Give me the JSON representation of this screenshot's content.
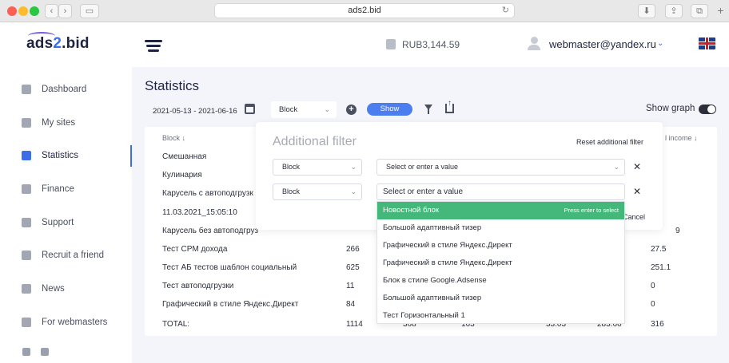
{
  "browser": {
    "url": "ads2.bid",
    "back_label": "‹",
    "forward_label": "›",
    "new_tab_label": "+"
  },
  "header": {
    "logo": {
      "prefix": "ads",
      "highlight": "2",
      "suffix": ".bid"
    },
    "balance": "RUB3,144.59",
    "user_email": "webmaster@yandex.ru",
    "language_flag": "uk-flag-icon"
  },
  "sidebar": {
    "items": [
      {
        "label": "Dashboard",
        "icon": "home-icon",
        "active": false
      },
      {
        "label": "My sites",
        "icon": "sites-icon",
        "active": false
      },
      {
        "label": "Statistics",
        "icon": "bar-chart-icon",
        "active": true
      },
      {
        "label": "Finance",
        "icon": "wallet-icon",
        "active": false
      },
      {
        "label": "Support",
        "icon": "chat-icon",
        "active": false
      },
      {
        "label": "Recruit a friend",
        "icon": "user-plus-icon",
        "active": false
      },
      {
        "label": "News",
        "icon": "news-icon",
        "active": false
      },
      {
        "label": "For webmasters",
        "icon": "info-icon",
        "active": false
      }
    ],
    "social": [
      "facebook-icon",
      "mail-icon"
    ]
  },
  "page": {
    "title": "Statistics",
    "date_range": "2021-05-13 - 2021-06-16",
    "block_select": "Block",
    "show_button": "Show",
    "show_graph_label": "Show graph",
    "show_graph_enabled": true
  },
  "table": {
    "headers": {
      "block": "Block ↓",
      "income": "l income ↓"
    },
    "rows": [
      {
        "block": "Смешанная",
        "c1": "",
        "c2": "",
        "c3": "",
        "c4": "",
        "c5": "",
        "c6": ""
      },
      {
        "block": "Кулинария",
        "c1": "",
        "c2": "",
        "c3": "",
        "c4": "",
        "c5": "",
        "c6": ""
      },
      {
        "block": "Карусель с автоподгрузк",
        "c1": "",
        "c2": "",
        "c3": "",
        "c4": "",
        "c5": "",
        "c6": ""
      },
      {
        "block": "11.03.2021_15:05:10",
        "c1": "",
        "c2": "",
        "c3": "",
        "c4": "",
        "c5": "",
        "c6": ""
      },
      {
        "block": "Карусель без автоподгруз",
        "c1": "",
        "c2": "",
        "c3": "",
        "c4": "",
        "c5": "",
        "c6": "9"
      },
      {
        "block": "Тест CPM дохода",
        "c1": "266",
        "c2": "",
        "c3": "",
        "c4": "",
        "c5": "",
        "c6": "27.5"
      },
      {
        "block": "Тест АБ тестов шаблон социальный",
        "c1": "625",
        "c2": "",
        "c3": "",
        "c4": "",
        "c5": "",
        "c6": "251.1"
      },
      {
        "block": "Тест автоподгрузки",
        "c1": "11",
        "c2": "",
        "c3": "",
        "c4": "",
        "c5": "",
        "c6": "0"
      },
      {
        "block": "Графический в стиле Яндекс.Директ",
        "c1": "84",
        "c2": "",
        "c3": "",
        "c4": "",
        "c5": "",
        "c6": "0"
      }
    ],
    "total": {
      "label": "TOTAL:",
      "c1": "1114",
      "c2": "368",
      "c3": "163",
      "c4": "33.03",
      "c5": "283.66",
      "c6": "316"
    }
  },
  "additional_filter": {
    "title": "Additional filter",
    "reset_label": "Reset additional filter",
    "cancel_label": "Cancel",
    "rows": [
      {
        "field": "Block",
        "value_placeholder": "Select or enter a value"
      },
      {
        "field": "Block",
        "value_placeholder": "Select or enter a value"
      }
    ],
    "close_symbol": "✕"
  },
  "dropdown": {
    "hint": "Press enter to select",
    "options": [
      "Новостной блок",
      "Большой адаптивный тизер",
      "Графический в стиле Яндекс.Директ",
      "Графический в стиле Яндекс.Директ",
      "Блок в стиле Google.Adsense",
      "Большой адаптивный тизер",
      "Тест Горизонтальный 1"
    ],
    "highlighted_index": 0
  },
  "colors": {
    "accent": "#3d6ee8",
    "show_button": "#4d7ef0",
    "highlight_green": "#43b87a",
    "main_bg": "#f4f5fb"
  }
}
